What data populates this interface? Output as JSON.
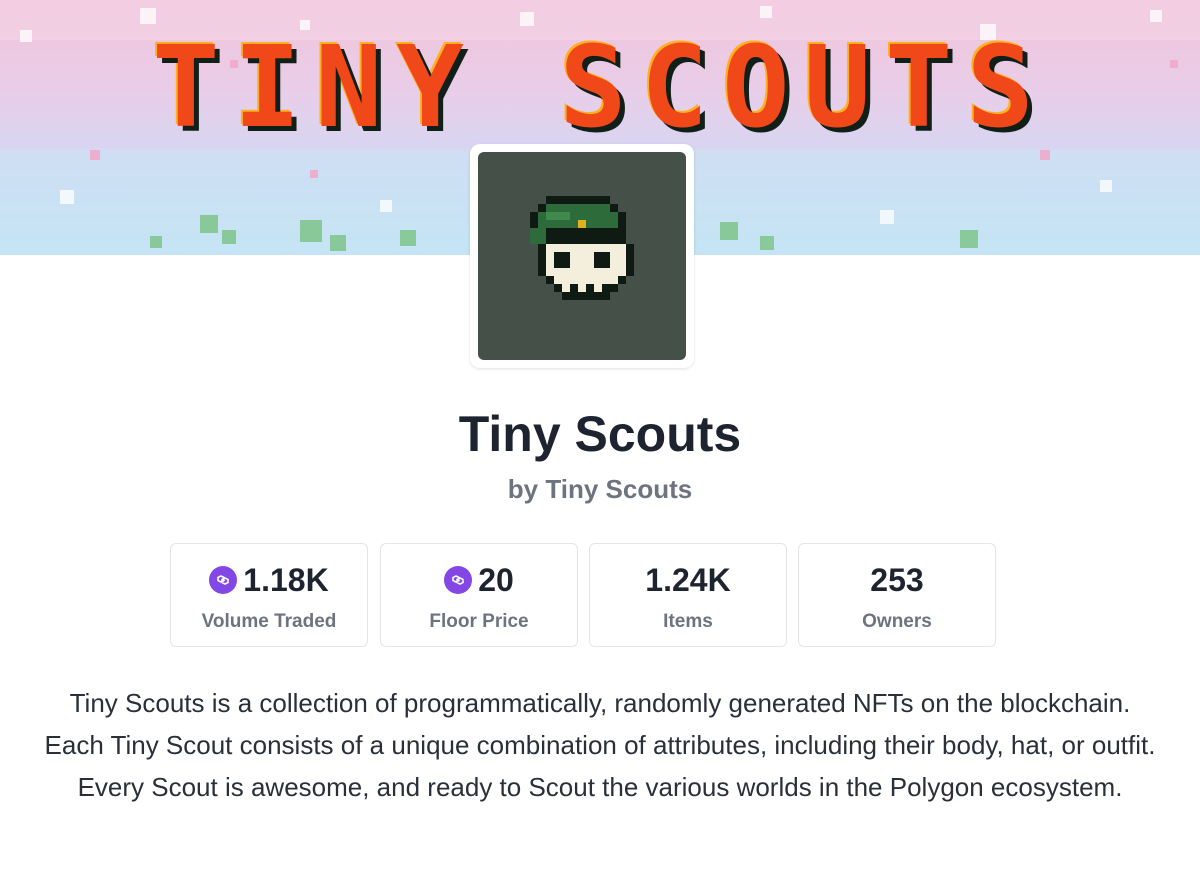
{
  "banner": {
    "title": "TINY SCOUTS"
  },
  "collection": {
    "name": "Tiny Scouts",
    "creator": "by Tiny Scouts"
  },
  "stats": [
    {
      "value": "1.18K",
      "label": "Volume Traded",
      "icon": "polygon-icon"
    },
    {
      "value": "20",
      "label": "Floor Price",
      "icon": "polygon-icon"
    },
    {
      "value": "1.24K",
      "label": "Items",
      "icon": ""
    },
    {
      "value": "253",
      "label": "Owners",
      "icon": ""
    }
  ],
  "description": "Tiny Scouts is a collection of programmatically, randomly generated NFTs on the blockchain. Each Tiny Scout consists of a unique combination of attributes, including their body, hat, or outfit. Every Scout is awesome, and ready to Scout the various worlds in the Polygon ecosystem.",
  "colors": {
    "polygon_purple": "#8247e5",
    "avatar_bg": "#455048",
    "banner_title": "#f04818"
  }
}
